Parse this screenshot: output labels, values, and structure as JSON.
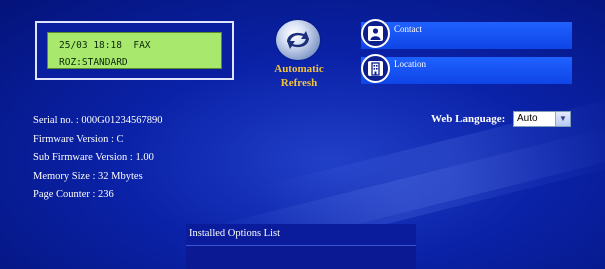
{
  "lcd": {
    "line1": "25/03 18:18  FAX",
    "line2": "ROZ:STANDARD"
  },
  "refresh": {
    "label_line1": "Automatic",
    "label_line2": "Refresh",
    "icon": "refresh-icon"
  },
  "links": [
    {
      "label": "Contact",
      "icon": "person-icon"
    },
    {
      "label": "Location",
      "icon": "building-icon"
    }
  ],
  "device_info": {
    "serial": "Serial no. : 000G01234567890",
    "firmware": "Firmware Version : C",
    "sub_firmware": "Sub Firmware Version : 1.00",
    "memory": "Memory Size : 32 Mbytes",
    "page_counter": "Page Counter : 236"
  },
  "web_language": {
    "label": "Web Language:",
    "selected": "Auto"
  },
  "installed_options": {
    "title": "Installed Options List"
  },
  "colors": {
    "background": "#0a22a8",
    "accent": "#f2c23a",
    "link_bar": "#1f62ff",
    "lcd": "#a8e86c"
  }
}
